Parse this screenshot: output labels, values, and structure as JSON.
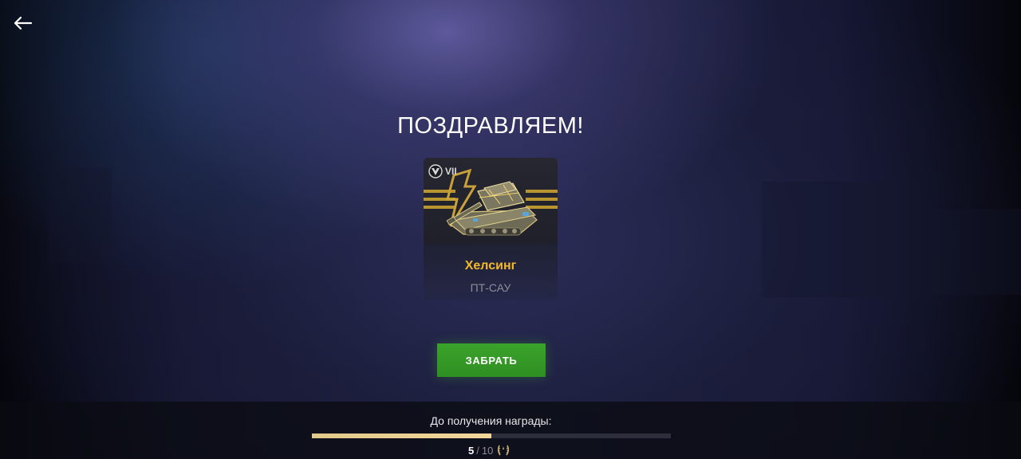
{
  "nav": {
    "back_icon": "arrow-left-icon"
  },
  "reward": {
    "title": "ПОЗДРАВЛЯЕМ!",
    "vehicle": {
      "tier": "VII",
      "tier_icon": "elite-vehicle-emblem-icon",
      "name": "Хелсинг",
      "class": "ПТ-САУ",
      "name_color": "#f4b82c"
    },
    "claim_button_label": "ЗАБРАТЬ",
    "claim_button_color": "#3aa32a"
  },
  "progress": {
    "label": "До получения награды:",
    "current": "5",
    "separator": "/",
    "total": "10",
    "fraction": 0.5,
    "fill_color": "#e2c98a",
    "reward_icon": "wreath-medal-icon"
  }
}
